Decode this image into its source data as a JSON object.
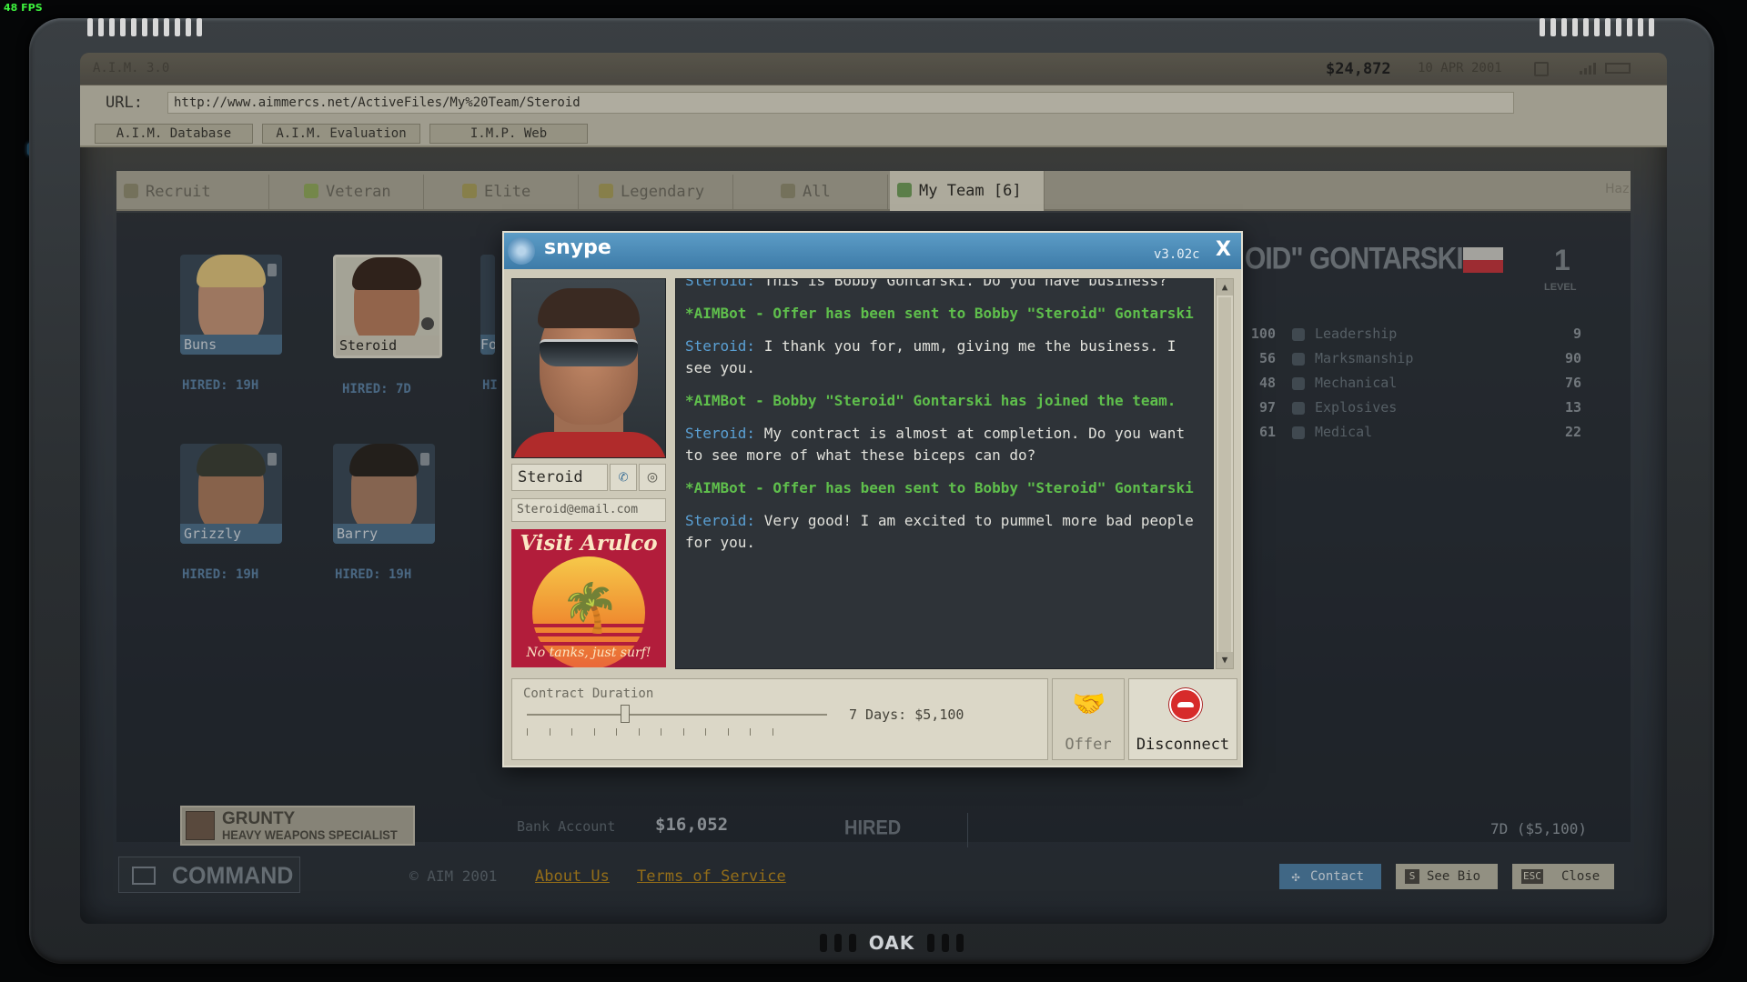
{
  "fps": "48 FPS",
  "topbar": {
    "version": "A.I.M. 3.0",
    "money": "$24,872",
    "date": "10 APR 2001"
  },
  "url": {
    "label": "URL:",
    "value": "http://www.aimmercs.net/ActiveFiles/My%20Team/Steroid"
  },
  "nav": [
    "A.I.M. Database",
    "A.I.M. Evaluation",
    "I.M.P. Web"
  ],
  "tabs": [
    {
      "label": "Recruit"
    },
    {
      "label": "Veteran"
    },
    {
      "label": "Elite"
    },
    {
      "label": "Legendary"
    },
    {
      "label": "All"
    },
    {
      "label": "My Team [6]"
    }
  ],
  "hazard_logo": "Haz",
  "mercs": [
    {
      "name": "Buns",
      "hired": "HIRED: 19H"
    },
    {
      "name": "Steroid",
      "hired": "HIRED: 7D"
    },
    {
      "name": "Fo",
      "hired": "HI"
    },
    {
      "name": "Grizzly",
      "hired": "HIRED: 19H"
    },
    {
      "name": "Barry",
      "hired": "HIRED: 19H"
    }
  ],
  "profile": {
    "name_fragment": "OID\" GONTARSKI",
    "level": "1",
    "level_label": "LEVEL",
    "stats": [
      {
        "left": "100",
        "name": "Leadership",
        "right": "9"
      },
      {
        "left": "56",
        "name": "Marksmanship",
        "right": "90"
      },
      {
        "left": "48",
        "name": "Mechanical",
        "right": "76"
      },
      {
        "left": "97",
        "name": "Explosives",
        "right": "13"
      },
      {
        "left": "61",
        "name": "Medical",
        "right": "22"
      }
    ]
  },
  "grunty": {
    "title": "GRUNTY",
    "subtitle": "HEAVY WEAPONS SPECIALIST"
  },
  "bank": {
    "label": "Bank Account",
    "value": "$16,052"
  },
  "hired_section": {
    "label": "HIRED",
    "value": "7D ($5,100)"
  },
  "footer": {
    "command": "COMMAND",
    "copyright": "© AIM 2001",
    "about": "About Us",
    "terms": "Terms of Service",
    "contact": "Contact",
    "see_bio": "See Bio",
    "see_bio_key": "S",
    "close": "Close",
    "close_key": "ESC"
  },
  "modal": {
    "title": "snype",
    "version": "v3.02c",
    "close": "X",
    "merc_name": "Steroid",
    "email": "Steroid@email.com",
    "ad_title": "Visit Arulco",
    "ad_tagline": "No tanks, just surf!",
    "messages": [
      {
        "who": "Steroid:",
        "text": " This is Bobby Gontarski. Do you have business?"
      },
      {
        "bot": true,
        "text": "*AIMBot - Offer has been sent to Bobby \"Steroid\" Gontarski"
      },
      {
        "who": "Steroid:",
        "text": " I thank you for, umm, giving me the business. I see you."
      },
      {
        "bot": true,
        "text": "*AIMBot - Bobby \"Steroid\" Gontarski has joined the team."
      },
      {
        "who": "Steroid:",
        "text": " My contract is almost at completion. Do you want to see more of what these biceps can do?"
      },
      {
        "bot": true,
        "text": "*AIMBot - Offer has been sent to Bobby \"Steroid\" Gontarski"
      },
      {
        "who": "Steroid:",
        "text": " Very good! I am excited to pummel more bad people for you."
      }
    ],
    "contract_label": "Contract Duration",
    "contract_value": "7 Days: $5,100",
    "contract_fraction": 0.4,
    "offer": "Offer",
    "disconnect": "Disconnect"
  },
  "colors": {
    "accent": "#3d7ba8",
    "bot_green": "#5fbf4c",
    "merc_blue": "#5aa0d4",
    "link": "#b4861f"
  }
}
